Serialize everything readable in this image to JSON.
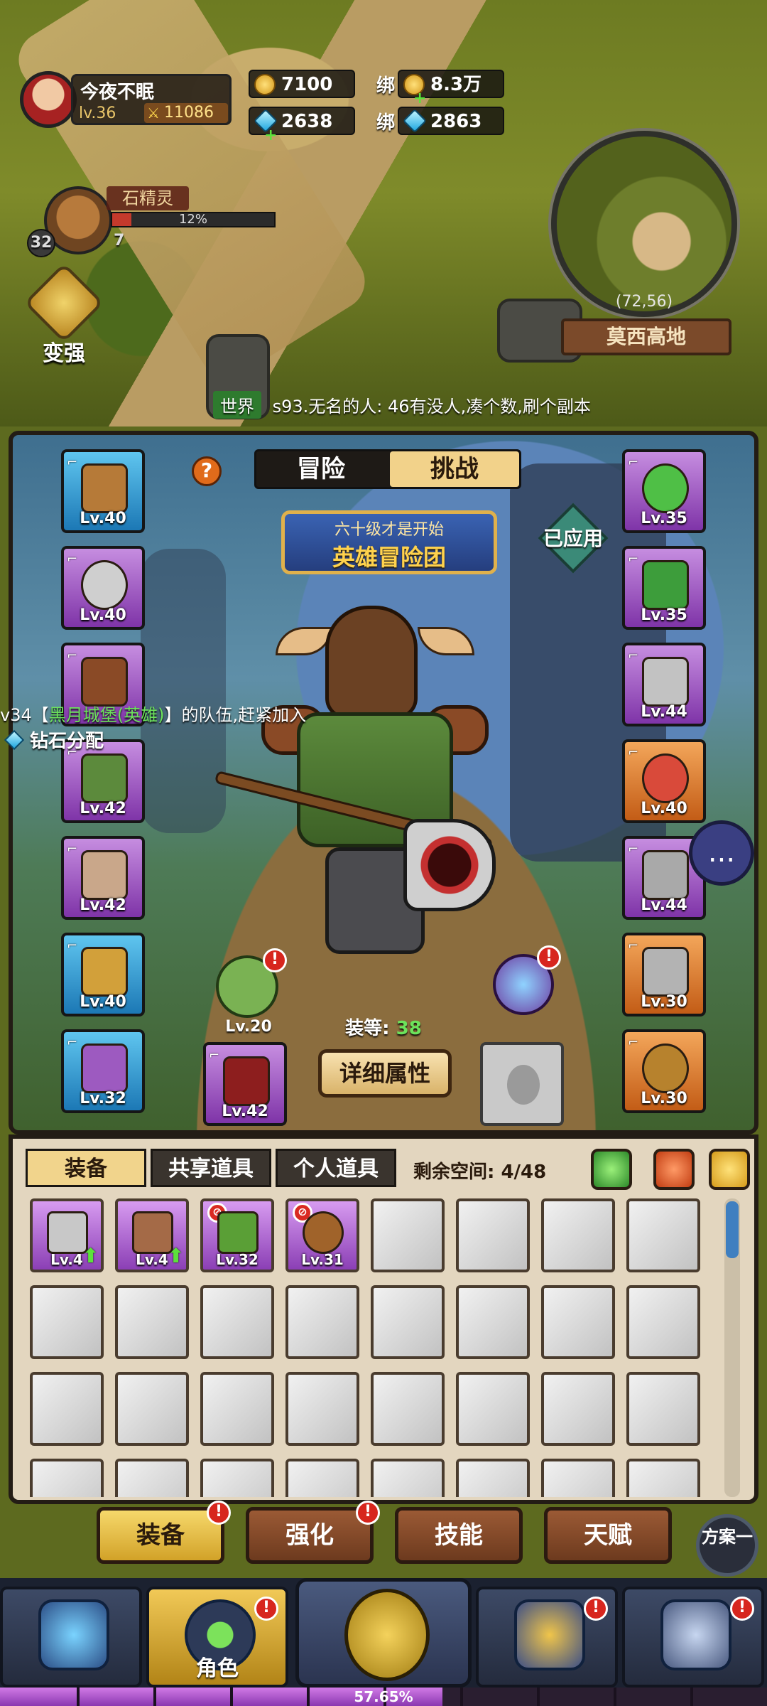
{
  "player": {
    "name": "今夜不眠",
    "level": "lv.36",
    "power": "11086"
  },
  "resources": {
    "gold": "7100",
    "diamond": "2638",
    "bound_label": "绑",
    "bound_gold": "8.3万",
    "bound_diamond": "2863"
  },
  "pet": {
    "name": "石精灵",
    "progress_text": "12%",
    "progress": 0.12,
    "num_a": "32",
    "num_b": "7"
  },
  "strengthen_label": "变强",
  "minimap": {
    "coord": "(72,56)",
    "location": "莫西高地"
  },
  "world_chat": {
    "tag": "世界",
    "message": "s93.无名的人: 46有没人,凑个数,刷个副本"
  },
  "panel": {
    "tabs": [
      "冒险",
      "挑战"
    ],
    "active_tab": "挑战",
    "help": "?",
    "banner_sub": "六十级才是开始",
    "banner_main": "英雄冒险团",
    "applied": "已应用",
    "gear_score_label": "装等:",
    "gear_score": "38",
    "detail_button": "详细属性",
    "left_slots": [
      {
        "level": "Lv.40",
        "rarity": "blue"
      },
      {
        "level": "Lv.40",
        "rarity": "purple"
      },
      {
        "level": "",
        "rarity": "purple"
      },
      {
        "level": "Lv.42",
        "rarity": "purple"
      },
      {
        "level": "Lv.42",
        "rarity": "purple"
      },
      {
        "level": "Lv.40",
        "rarity": "blue"
      },
      {
        "level": "Lv.32",
        "rarity": "blue"
      }
    ],
    "right_slots": [
      {
        "level": "Lv.35",
        "rarity": "purple"
      },
      {
        "level": "Lv.35",
        "rarity": "purple"
      },
      {
        "level": "Lv.44",
        "rarity": "purple"
      },
      {
        "level": "Lv.40",
        "rarity": "orange"
      },
      {
        "level": "Lv.44",
        "rarity": "purple"
      },
      {
        "level": "Lv.30",
        "rarity": "orange"
      },
      {
        "level": "Lv.30",
        "rarity": "orange"
      }
    ],
    "armor_badge_level": "Lv.20",
    "weapon_slot_level": "Lv.42",
    "guild_msg_prefix": "v34【",
    "guild_msg_name": "黑月城堡(英雄)",
    "guild_msg_suffix": "】的队伍,赶紧加入",
    "diamond_alloc": "钻石分配",
    "badge_mark": "!",
    "chat_icon": "..."
  },
  "inventory": {
    "tabs": [
      "装备",
      "共享道具",
      "个人道具"
    ],
    "active_tab": "装备",
    "space": "剩余空间: 4/48",
    "items": [
      {
        "level": "Lv.4",
        "flag": "up"
      },
      {
        "level": "Lv.4",
        "flag": "up"
      },
      {
        "level": "Lv.32",
        "flag": "ban"
      },
      {
        "level": "Lv.31",
        "flag": "ban"
      }
    ]
  },
  "subtabs": [
    "装备",
    "强化",
    "技能",
    "天赋"
  ],
  "plan_button": "方案一",
  "nav": {
    "role_label": "角色"
  },
  "xp": {
    "text": "57.65%",
    "value": 0.5765
  }
}
